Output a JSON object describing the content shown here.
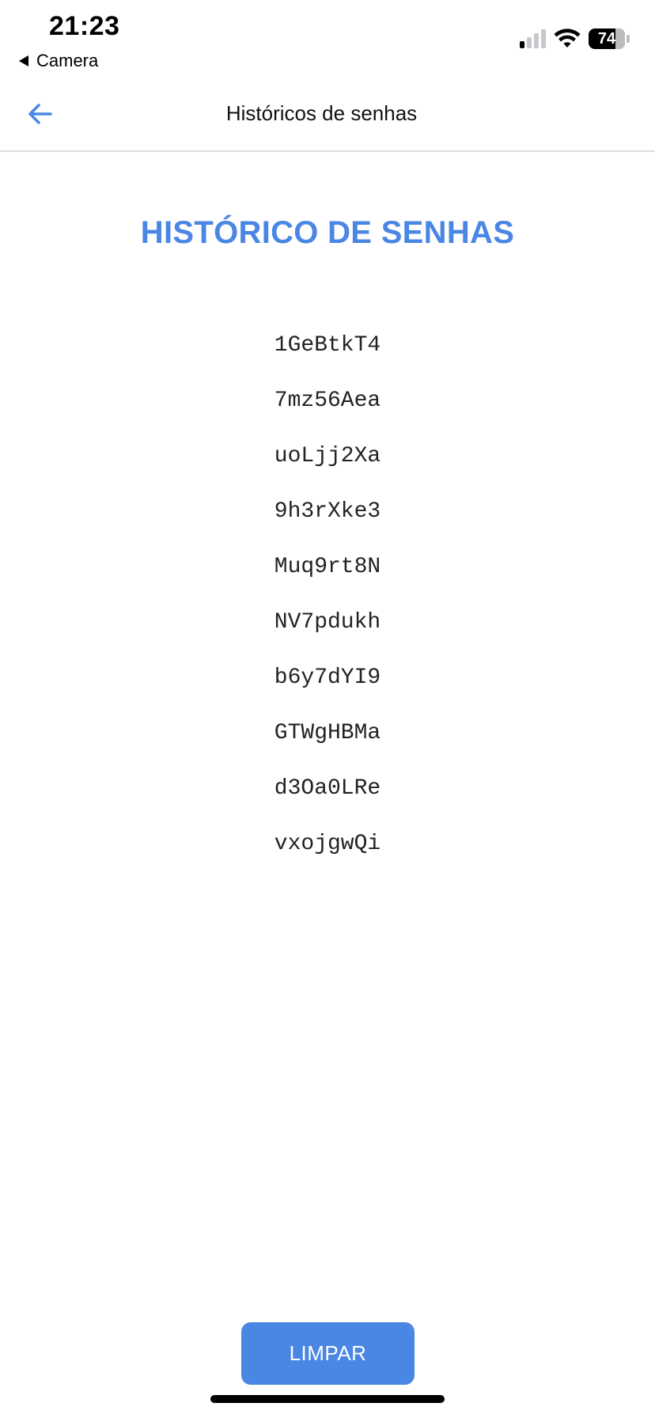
{
  "status_bar": {
    "time": "21:23",
    "back_app": "Camera",
    "battery_percent": "74",
    "signal_bars_on": 1,
    "signal_bars_total": 4,
    "icons": [
      "back-triangle-icon",
      "signal-icon",
      "wifi-icon",
      "battery-icon"
    ]
  },
  "header": {
    "title": "Históricos de senhas",
    "back_icon": "arrow-left-icon"
  },
  "main": {
    "heading": "HISTÓRICO DE SENHAS",
    "passwords": [
      "1GeBtkT4",
      "7mz56Aea",
      "uoLjj2Xa",
      "9h3rXke3",
      "Muq9rt8N",
      "NV7pdukh",
      "b6y7dYI9",
      "GTWgHBMa",
      "d3Oa0LRe",
      "vxojgwQi"
    ]
  },
  "actions": {
    "clear_label": "LIMPAR"
  },
  "colors": {
    "accent": "#4a86e4",
    "divider": "#dedede",
    "text": "#222222"
  }
}
